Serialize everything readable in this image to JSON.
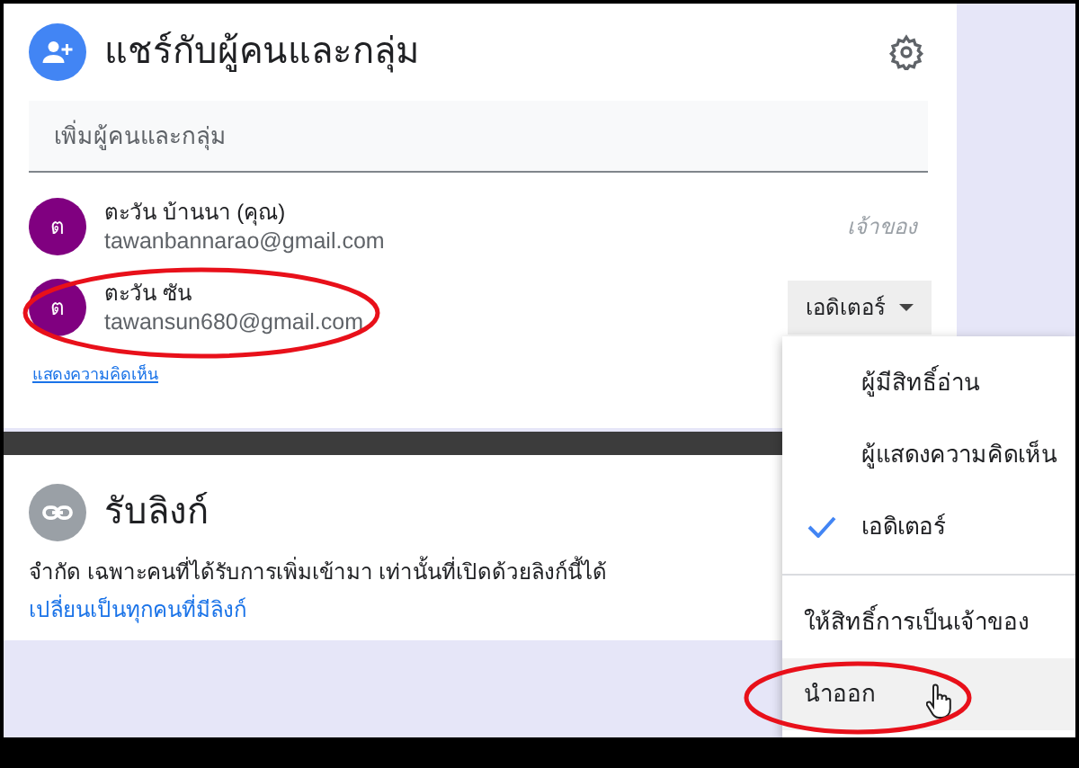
{
  "share": {
    "title": "แชร์กับผู้คนและกลุ่ม",
    "input": {
      "placeholder": "เพิ่มผู้คนและกลุ่ม"
    },
    "people": [
      {
        "initial": "ต",
        "name": "ตะวัน บ้านนา (คุณ)",
        "email": "tawanbannarao@gmail.com",
        "role": "เจ้าของ",
        "kind": "owner",
        "circled": false
      },
      {
        "initial": "ต",
        "name": "ตะวัน ซัน",
        "email": "tawansun680@gmail.com",
        "role": "เอดิเตอร์",
        "kind": "dropdown",
        "circled": true
      }
    ],
    "comments_link": "แสดงความคิดเห็น"
  },
  "link_section": {
    "title": "รับลิงก์",
    "description": "จำกัด เฉพาะคนที่ได้รับการเพิ่มเข้ามา เท่านั้นที่เปิดด้วยลิงก์นี้ได้",
    "change_link": "เปลี่ยนเป็นทุกคนที่มีลิงก์"
  },
  "role_menu": {
    "roles": [
      {
        "label": "ผู้มีสิทธิ์อ่าน",
        "selected": false
      },
      {
        "label": "ผู้แสดงความคิดเห็น",
        "selected": false
      },
      {
        "label": "เอดิเตอร์",
        "selected": true
      }
    ],
    "actions": [
      {
        "label": "ให้สิทธิ์การเป็นเจ้าของ",
        "hovered": false,
        "circled": false
      },
      {
        "label": "นำออก",
        "hovered": true,
        "circled": true
      }
    ]
  }
}
